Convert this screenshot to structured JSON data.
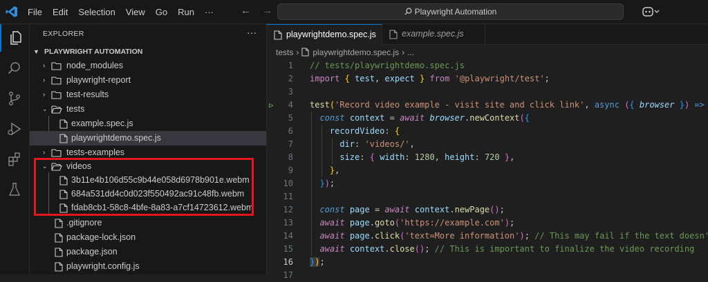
{
  "menu": [
    "File",
    "Edit",
    "Selection",
    "View",
    "Go",
    "Run",
    "···"
  ],
  "nav": {
    "back": "←",
    "forward": "→"
  },
  "search": {
    "text": "Playwright Automation"
  },
  "sidebar": {
    "title": "EXPLORER",
    "more": "···",
    "folder": "PLAYWRIGHT AUTOMATION",
    "items": [
      {
        "label": "node_modules",
        "type": "folder",
        "expanded": false
      },
      {
        "label": "playwright-report",
        "type": "folder",
        "expanded": false
      },
      {
        "label": "test-results",
        "type": "folder",
        "expanded": false
      },
      {
        "label": "tests",
        "type": "folder",
        "expanded": true
      },
      {
        "label": "example.spec.js",
        "type": "file"
      },
      {
        "label": "playwrightdemo.spec.js",
        "type": "file",
        "selected": true
      },
      {
        "label": "tests-examples",
        "type": "folder",
        "expanded": false
      },
      {
        "label": "videos",
        "type": "folder",
        "expanded": true
      },
      {
        "label": "3b11e4b106d55c9b44e058d6978b901e.webm",
        "type": "file"
      },
      {
        "label": "684a531dd4c0d023f550492ac91c48fb.webm",
        "type": "file"
      },
      {
        "label": "fdab8cb1-58c8-4bfe-8a83-a7cf14723612.webm",
        "type": "file"
      },
      {
        "label": ".gitignore",
        "type": "file"
      },
      {
        "label": "package-lock.json",
        "type": "file"
      },
      {
        "label": "package.json",
        "type": "file"
      },
      {
        "label": "playwright.config.js",
        "type": "file"
      }
    ]
  },
  "tabs": [
    {
      "label": "playwrightdemo.spec.js",
      "active": true
    },
    {
      "label": "example.spec.js",
      "active": false
    }
  ],
  "breadcrumb": {
    "folder": "tests",
    "file": "playwrightdemo.spec.js",
    "more": "..."
  },
  "code": {
    "current_line": 16,
    "line_numbers": [
      "1",
      "2",
      "3",
      "4",
      "5",
      "6",
      "7",
      "8",
      "9",
      "10",
      "11",
      "12",
      "13",
      "14",
      "15",
      "16",
      "17"
    ],
    "l1": "// tests/playwrightdemo.spec.js",
    "l2_a": "import",
    "l2_b": "{",
    "l2_c": "test",
    "l2_d": "expect",
    "l2_e": "}",
    "l2_f": "from",
    "l2_g": "'@playwright/test'",
    "l4_a": "test",
    "l4_b": "'Record video example - visit site and click link'",
    "l4_c": "async",
    "l4_d": "browser",
    "l5_a": "const",
    "l5_b": "context",
    "l5_c": "await",
    "l5_d": "browser",
    "l5_e": "newContext",
    "l6_a": "recordVideo",
    "l7_a": "dir",
    "l7_b": "'videos/'",
    "l8_a": "size",
    "l8_b": "width",
    "l8_c": "1280",
    "l8_d": "height",
    "l8_e": "720",
    "l12_a": "const",
    "l12_b": "page",
    "l12_c": "await",
    "l12_d": "context",
    "l12_e": "newPage",
    "l13_a": "await",
    "l13_b": "page",
    "l13_c": "goto",
    "l13_d": "'https://example.com'",
    "l14_a": "await",
    "l14_b": "page",
    "l14_c": "click",
    "l14_d": "'text=More information'",
    "l14_e": "// This may fail if the text doesn'",
    "l15_a": "await",
    "l15_b": "context",
    "l15_c": "close",
    "l15_d": "// This is important to finalize the video recording"
  },
  "colors": {
    "accent": "#0078d4",
    "highlight_box": "#e3161b",
    "run_icon": "#89d185"
  }
}
